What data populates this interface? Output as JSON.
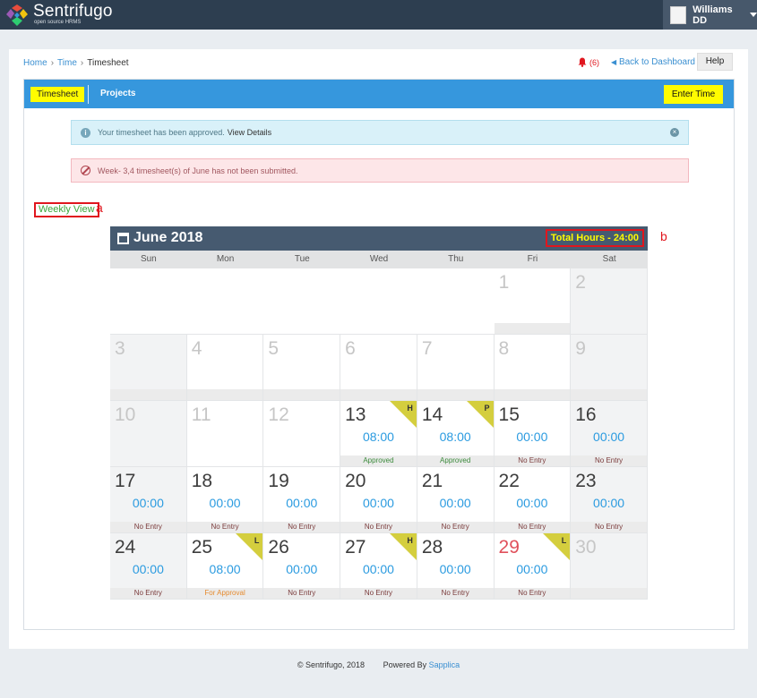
{
  "app": {
    "name": "Sentrifugo",
    "tagline": "open source HRMS",
    "user": "Williams DD"
  },
  "breadcrumb": [
    "Home",
    "Time",
    "Timesheet"
  ],
  "toolbar": {
    "notifications": "(6)",
    "back": "Back to Dashboard",
    "help": "Help"
  },
  "tabs": {
    "active": "Timesheet",
    "second": "Projects",
    "enter_time": "Enter Time"
  },
  "alerts": {
    "info": "Your timesheet has been approved.",
    "info_link": "View Details",
    "danger": "Week- 3,4 timesheet(s) of June has not been submitted."
  },
  "view_label": "Weekly View",
  "marks": {
    "a": "a",
    "b": "b"
  },
  "calendar": {
    "month": "June 2018",
    "total_hours": "Total Hours - 24:00",
    "days": [
      "Sun",
      "Mon",
      "Tue",
      "Wed",
      "Thu",
      "Fri",
      "Sat"
    ],
    "weeks": [
      [
        null,
        null,
        null,
        null,
        null,
        {
          "day": "1",
          "state": "light",
          "status": ""
        },
        {
          "day": "2",
          "state": "light",
          "dim": true
        }
      ],
      [
        {
          "day": "3",
          "state": "light",
          "dim": true,
          "status": ""
        },
        {
          "day": "4",
          "state": "light",
          "status": ""
        },
        {
          "day": "5",
          "state": "light",
          "status": ""
        },
        {
          "day": "6",
          "state": "light",
          "status": ""
        },
        {
          "day": "7",
          "state": "light",
          "status": ""
        },
        {
          "day": "8",
          "state": "light",
          "status": ""
        },
        {
          "day": "9",
          "state": "light",
          "dim": true,
          "status": ""
        }
      ],
      [
        {
          "day": "10",
          "state": "light",
          "dim": true
        },
        {
          "day": "11",
          "state": "light"
        },
        {
          "day": "12",
          "state": "light"
        },
        {
          "day": "13",
          "hours": "08:00",
          "status": "Approved",
          "status_type": "approved",
          "tag": "H"
        },
        {
          "day": "14",
          "hours": "08:00",
          "status": "Approved",
          "status_type": "approved",
          "tag": "P"
        },
        {
          "day": "15",
          "hours": "00:00",
          "status": "No Entry",
          "status_type": "none"
        },
        {
          "day": "16",
          "hours": "00:00",
          "status": "No Entry",
          "status_type": "none",
          "dim": true
        }
      ],
      [
        {
          "day": "17",
          "hours": "00:00",
          "status": "No Entry",
          "status_type": "none",
          "dim": true
        },
        {
          "day": "18",
          "hours": "00:00",
          "status": "No Entry",
          "status_type": "none"
        },
        {
          "day": "19",
          "hours": "00:00",
          "status": "No Entry",
          "status_type": "none"
        },
        {
          "day": "20",
          "hours": "00:00",
          "status": "No Entry",
          "status_type": "none"
        },
        {
          "day": "21",
          "hours": "00:00",
          "status": "No Entry",
          "status_type": "none"
        },
        {
          "day": "22",
          "hours": "00:00",
          "status": "No Entry",
          "status_type": "none"
        },
        {
          "day": "23",
          "hours": "00:00",
          "status": "No Entry",
          "status_type": "none",
          "dim": true
        }
      ],
      [
        {
          "day": "24",
          "hours": "00:00",
          "status": "No Entry",
          "status_type": "none",
          "dim": true
        },
        {
          "day": "25",
          "hours": "08:00",
          "status": "For Approval",
          "status_type": "pending",
          "tag": "L"
        },
        {
          "day": "26",
          "hours": "00:00",
          "status": "No Entry",
          "status_type": "none"
        },
        {
          "day": "27",
          "hours": "00:00",
          "status": "No Entry",
          "status_type": "none",
          "tag": "H"
        },
        {
          "day": "28",
          "hours": "00:00",
          "status": "No Entry",
          "status_type": "none"
        },
        {
          "day": "29",
          "hours": "00:00",
          "status": "No Entry",
          "status_type": "none",
          "tag": "L",
          "state": "red"
        },
        {
          "day": "30",
          "state": "light",
          "dim": true,
          "status": ""
        }
      ]
    ]
  },
  "footer": {
    "copyright": "© Sentrifugo, 2018",
    "powered": "Powered By",
    "brand": "Sapplica"
  },
  "colors": {
    "topbar": "#2d3e50",
    "tabbar": "#3697dd",
    "highlight": "#fffc00",
    "hours": "#2b9be0",
    "tag": "#d4ce3e"
  }
}
